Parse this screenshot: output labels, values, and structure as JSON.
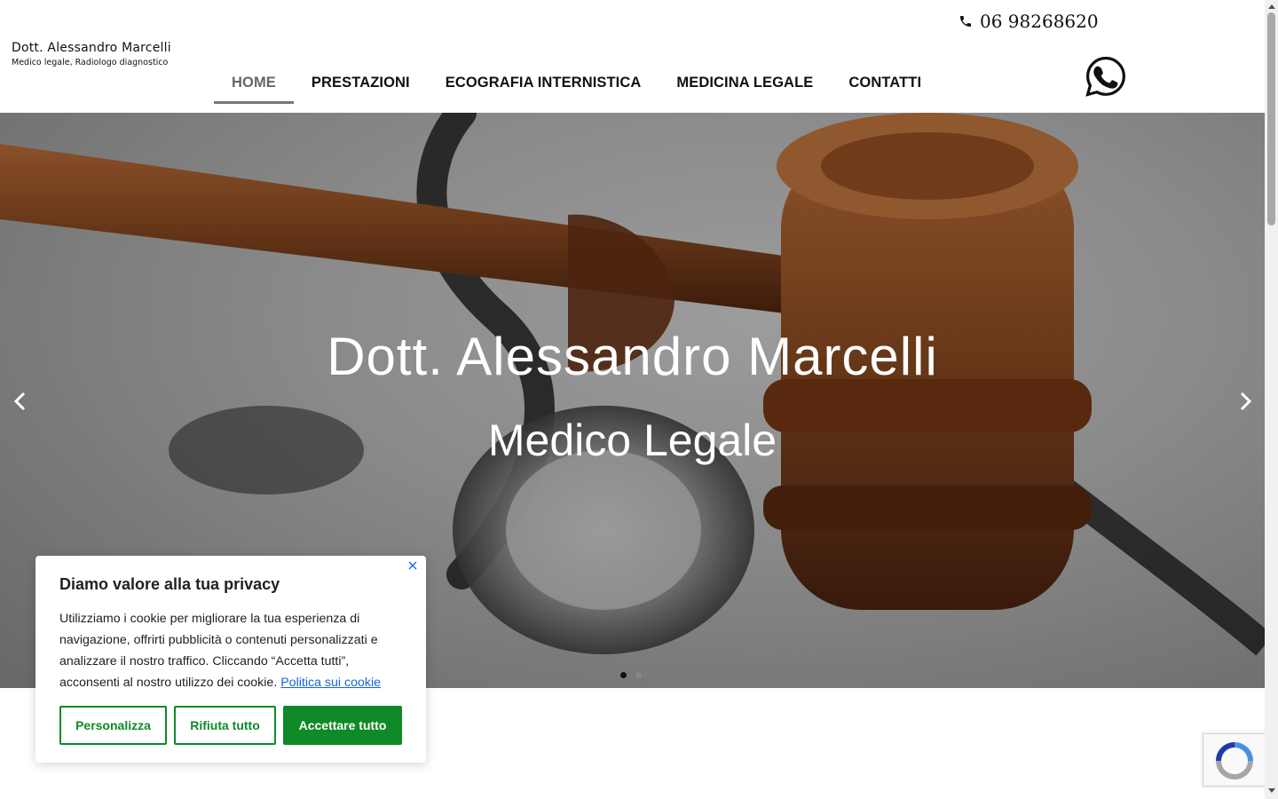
{
  "header": {
    "logo_name": "Dott. Alessandro Marcelli",
    "logo_subtitle": "Medico legale, Radiologo diagnostico",
    "phone": "06 98268620",
    "nav": [
      {
        "label": "HOME",
        "active": true
      },
      {
        "label": "PRESTAZIONI",
        "active": false
      },
      {
        "label": "ECOGRAFIA INTERNISTICA",
        "active": false
      },
      {
        "label": "MEDICINA LEGALE",
        "active": false
      },
      {
        "label": "CONTATTI",
        "active": false
      }
    ]
  },
  "hero": {
    "title": "Dott. Alessandro Marcelli",
    "subtitle": "Medico Legale",
    "slides": 2,
    "active_slide": 1
  },
  "cookie": {
    "title": "Diamo valore alla tua privacy",
    "text": "Utilizziamo i cookie per migliorare la tua esperienza di navigazione, offrirti pubblicità o contenuti personalizzati e analizzare il nostro traffico. Cliccando “Accetta tutti”, acconsenti al nostro utilizzo dei cookie.",
    "link": "Politica sui cookie",
    "buttons": {
      "customize": "Personalizza",
      "reject": "Rifiuta tutto",
      "accept": "Accettare tutto"
    }
  },
  "colors": {
    "accent_green": "#0f8a26",
    "link_blue": "#1863dc",
    "nav_active": "#666666"
  },
  "icons": [
    "phone-icon",
    "whatsapp-icon",
    "chevron-left-icon",
    "chevron-right-icon",
    "close-icon",
    "recaptcha-icon"
  ]
}
